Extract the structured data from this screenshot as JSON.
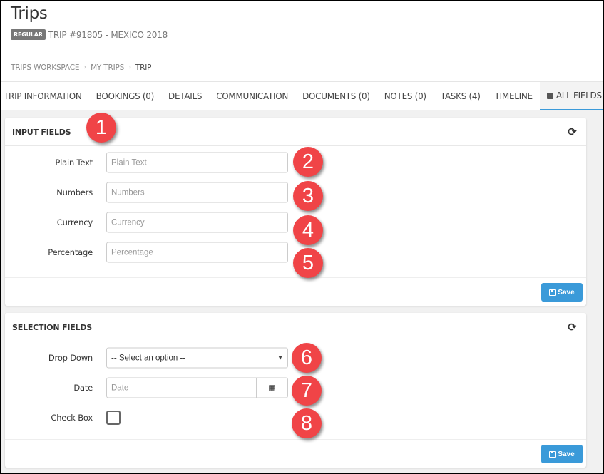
{
  "header": {
    "title": "Trips",
    "badge": "REGULAR",
    "trip_name": "TRIP #91805 - MEXICO 2018"
  },
  "breadcrumb": {
    "items": [
      "TRIPS WORKSPACE",
      "MY TRIPS",
      "TRIP"
    ],
    "separator": ">"
  },
  "tabs": [
    {
      "label": "TRIP INFORMATION"
    },
    {
      "label": "BOOKINGS (0)"
    },
    {
      "label": "DETAILS"
    },
    {
      "label": "COMMUNICATION"
    },
    {
      "label": "DOCUMENTS (0)"
    },
    {
      "label": "NOTES (0)"
    },
    {
      "label": "TASKS (4)"
    },
    {
      "label": "TIMELINE"
    },
    {
      "label": "ALL FIELDS",
      "icon": "cube-icon",
      "active": true
    }
  ],
  "input_panel": {
    "title": "INPUT FIELDS",
    "refresh_icon": "refresh-icon",
    "fields": [
      {
        "label": "Plain Text",
        "placeholder": "Plain Text"
      },
      {
        "label": "Numbers",
        "placeholder": "Numbers"
      },
      {
        "label": "Currency",
        "placeholder": "Currency"
      },
      {
        "label": "Percentage",
        "placeholder": "Percentage"
      }
    ],
    "save_label": "Save"
  },
  "selection_panel": {
    "title": "SELECTION FIELDS",
    "refresh_icon": "refresh-icon",
    "dropdown": {
      "label": "Drop Down",
      "value": "-- Select an option --"
    },
    "date": {
      "label": "Date",
      "placeholder": "Date"
    },
    "checkbox": {
      "label": "Check Box",
      "checked": false
    },
    "save_label": "Save"
  },
  "markers": [
    "1",
    "2",
    "3",
    "4",
    "5",
    "6",
    "7",
    "8"
  ],
  "colors": {
    "accent": "#3a9ad9",
    "marker": "#f04447",
    "badge": "#777777"
  }
}
